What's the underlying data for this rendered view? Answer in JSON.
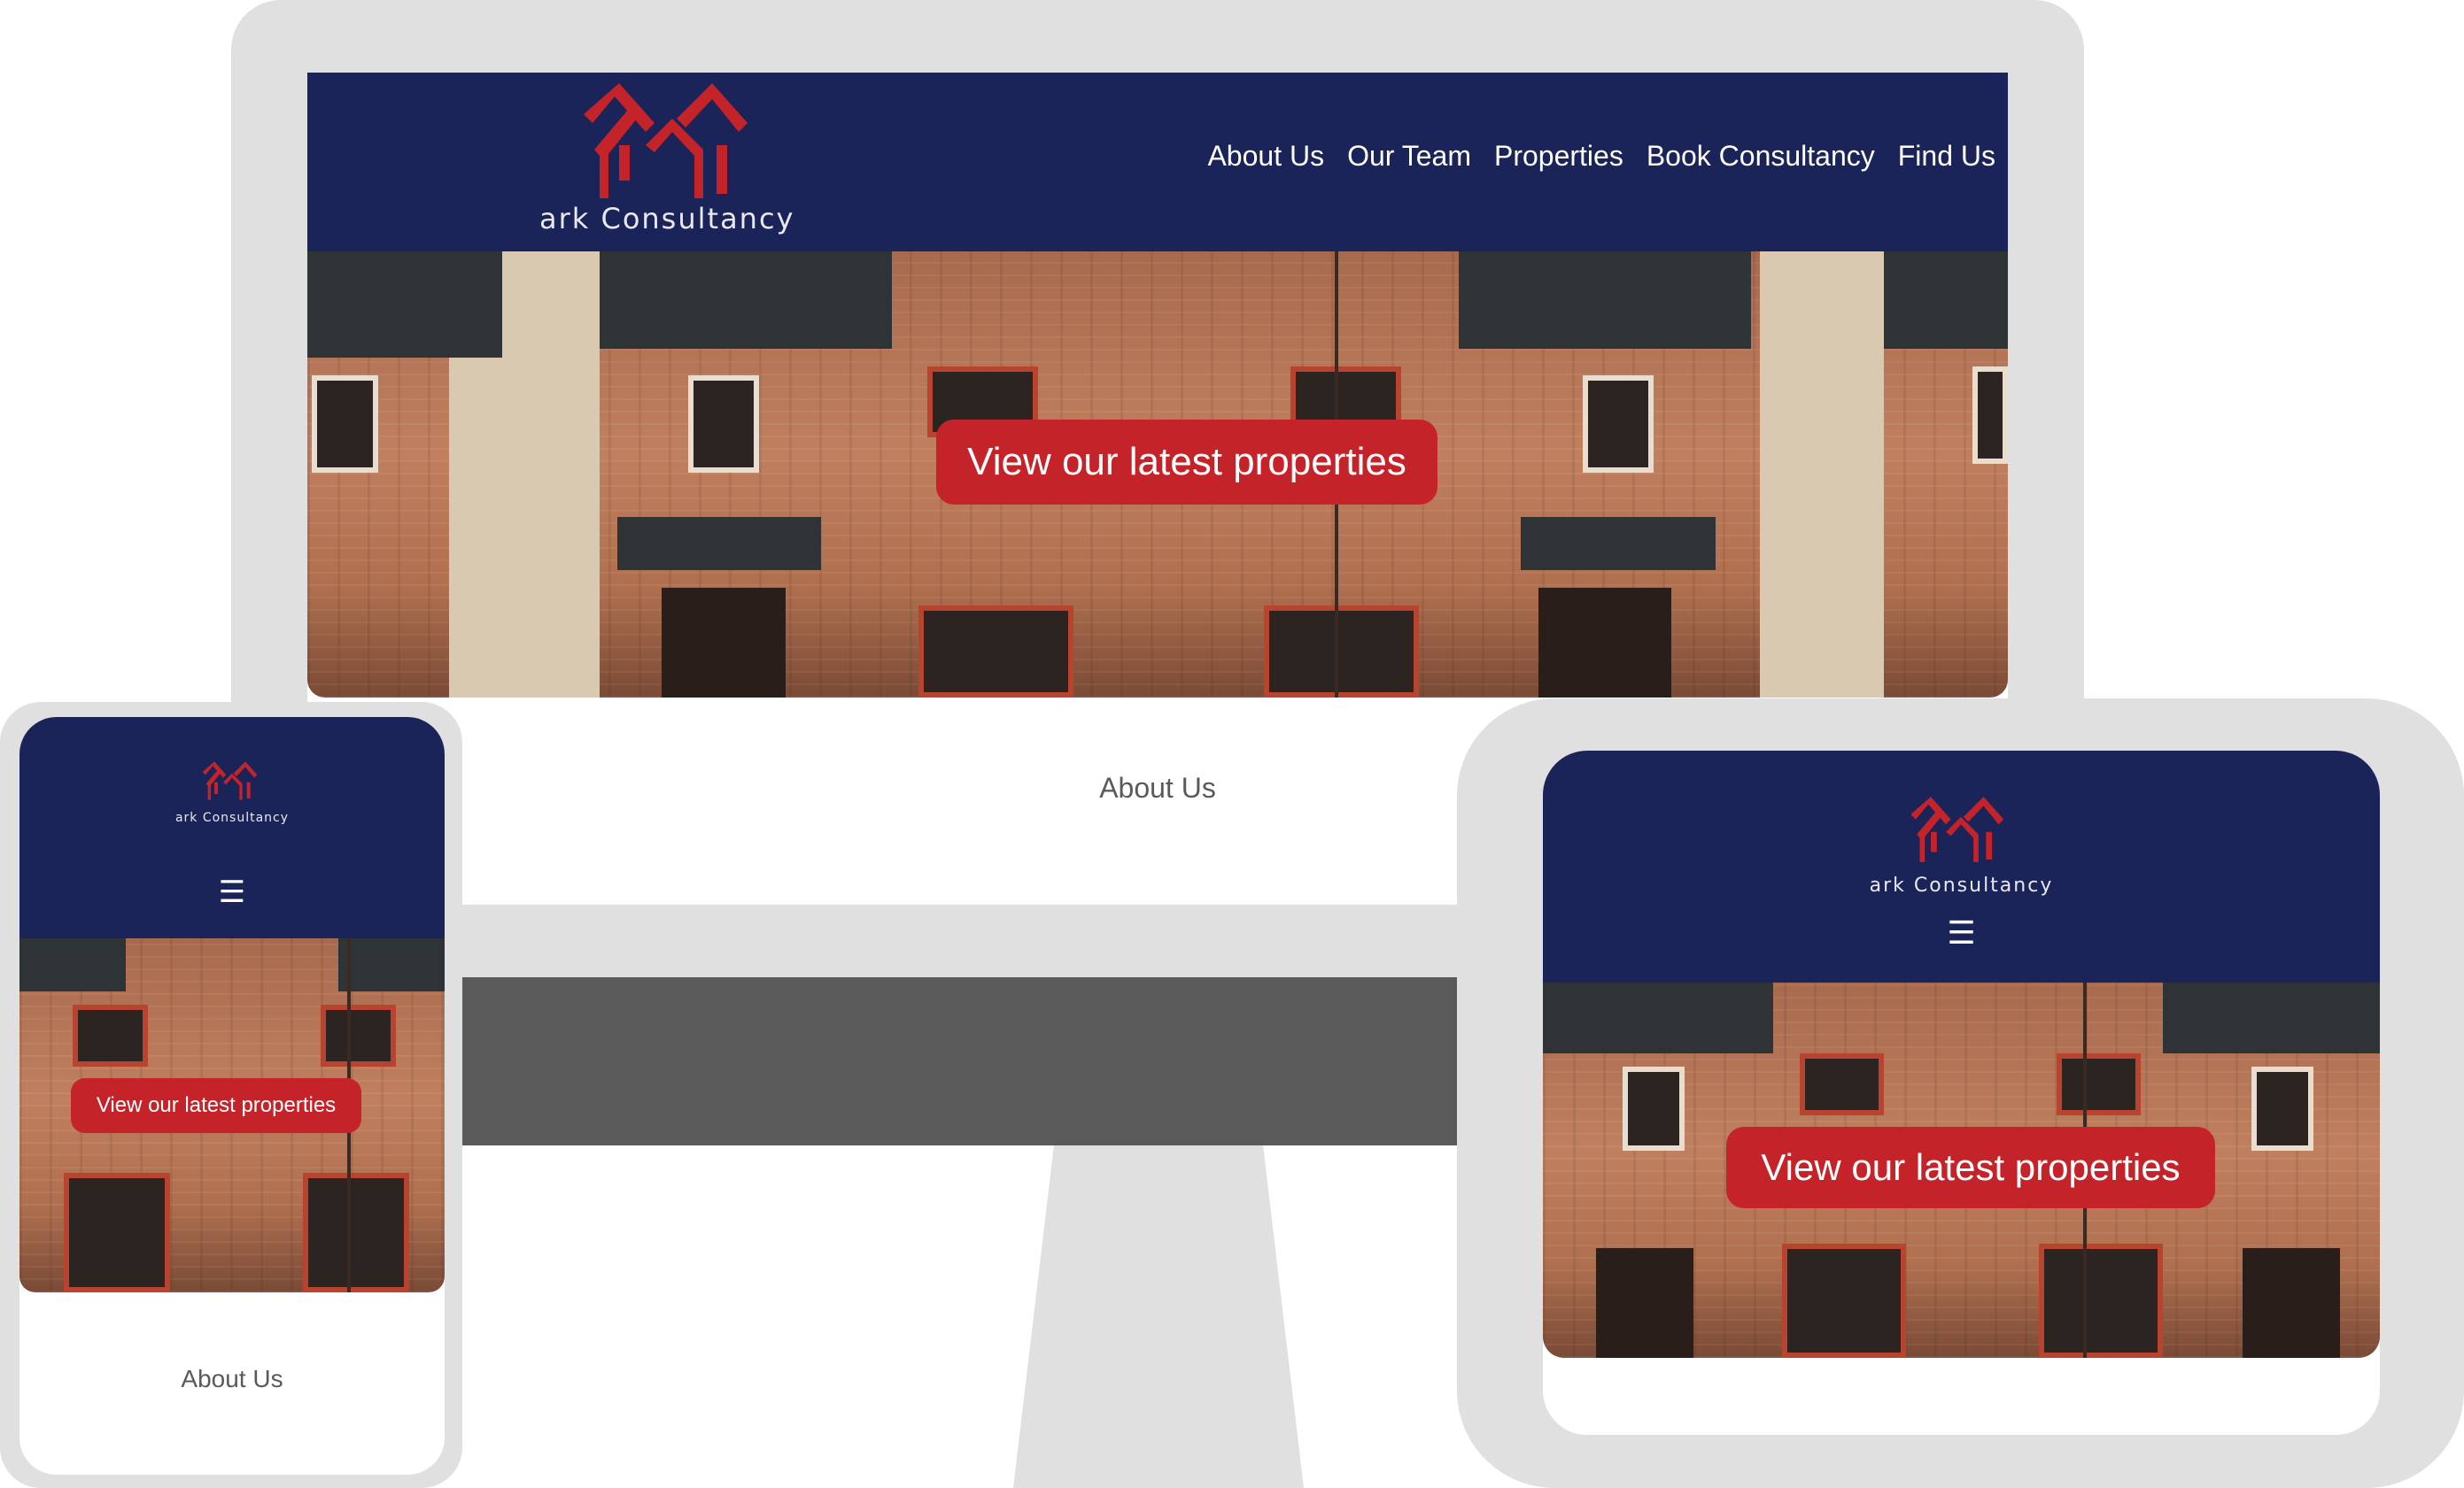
{
  "brand": {
    "name": "ark Consultancy",
    "accent": "#c5232a",
    "navy": "#1b2459"
  },
  "nav": {
    "items": [
      "About Us",
      "Our Team",
      "Properties",
      "Book Consultancy",
      "Find Us"
    ]
  },
  "hero": {
    "cta_label": "View our latest properties"
  },
  "section": {
    "about_heading": "About Us"
  },
  "icons": {
    "menu": "hamburger-icon",
    "logo": "houses-logo-icon"
  },
  "mobile_menu_glyph": "☰"
}
